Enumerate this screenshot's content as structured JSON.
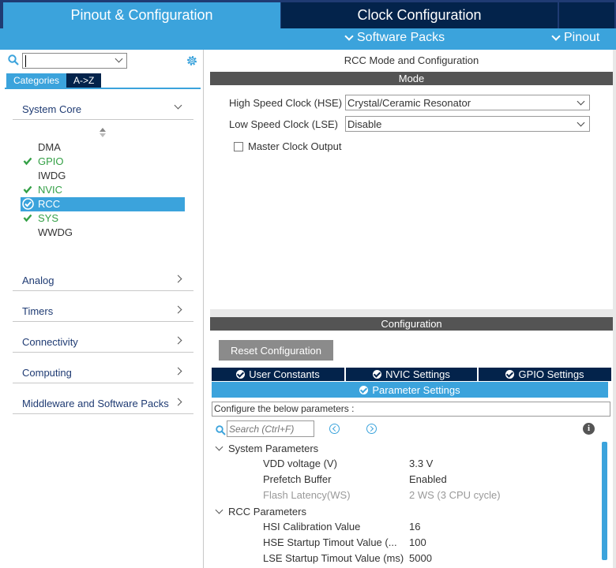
{
  "top_tabs": {
    "pinout_config": "Pinout & Configuration",
    "clock_config": "Clock Configuration"
  },
  "subbar": {
    "software_packs": "Software Packs",
    "pinout": "Pinout"
  },
  "left": {
    "category_tabs": [
      "Categories",
      "A->Z"
    ],
    "sections": {
      "system_core": "System Core",
      "analog": "Analog",
      "timers": "Timers",
      "connectivity": "Connectivity",
      "computing": "Computing",
      "middleware": "Middleware and Software Packs"
    },
    "peripherals": [
      {
        "name": "DMA",
        "state": "none"
      },
      {
        "name": "GPIO",
        "state": "ok"
      },
      {
        "name": "IWDG",
        "state": "none"
      },
      {
        "name": "NVIC",
        "state": "ok"
      },
      {
        "name": "RCC",
        "state": "selected"
      },
      {
        "name": "SYS",
        "state": "ok"
      },
      {
        "name": "WWDG",
        "state": "none"
      }
    ]
  },
  "mode": {
    "title": "RCC Mode and Configuration",
    "bar": "Mode",
    "hse_label": "High Speed Clock (HSE)",
    "hse_value": "Crystal/Ceramic Resonator",
    "lse_label": "Low Speed Clock (LSE)",
    "lse_value": "Disable",
    "mco_label": "Master Clock Output",
    "mco_checked": false
  },
  "config": {
    "bar": "Configuration",
    "reset_button": "Reset Configuration",
    "tabs": [
      "User Constants",
      "NVIC Settings",
      "GPIO Settings"
    ],
    "active_tab": "Parameter Settings",
    "description": "Configure the below parameters :",
    "search_placeholder": "Search (Ctrl+F)",
    "groups": {
      "system": "System Parameters",
      "rcc": "RCC Parameters"
    },
    "system_params": [
      {
        "name": "VDD voltage (V)",
        "value": "3.3 V",
        "dim": false
      },
      {
        "name": "Prefetch Buffer",
        "value": "Enabled",
        "dim": false
      },
      {
        "name": "Flash Latency(WS)",
        "value": "2 WS (3 CPU cycle)",
        "dim": true
      }
    ],
    "rcc_params": [
      {
        "name": "HSI Calibration Value",
        "value": "16",
        "dim": false
      },
      {
        "name": "HSE Startup Timout Value (...",
        "value": "100",
        "dim": false
      },
      {
        "name": "LSE Startup Timout Value (ms)",
        "value": "5000",
        "dim": false
      }
    ]
  },
  "colors": {
    "accent_blue": "#3ba3dc",
    "navy": "#03234b",
    "ok_green": "#34a046",
    "bar_gray": "#545454"
  }
}
